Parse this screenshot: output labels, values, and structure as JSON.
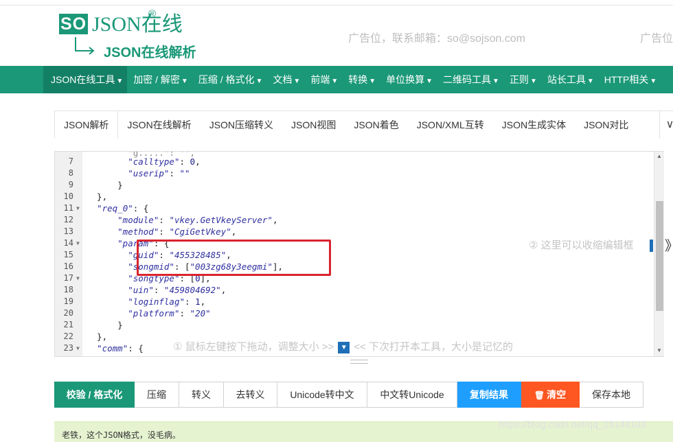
{
  "header": {
    "logo_so": "SO",
    "logo_json": "JSON在线",
    "logo_reg": "®",
    "logo_sub": "JSON在线解析",
    "ad_text": "广告位，联系邮箱：so@sojson.com",
    "ad_text_2": "广告位"
  },
  "nav": {
    "items": [
      {
        "label": "JSON在线工具"
      },
      {
        "label": "加密 / 解密"
      },
      {
        "label": "压缩 / 格式化"
      },
      {
        "label": "文档"
      },
      {
        "label": "前端"
      },
      {
        "label": "转换"
      },
      {
        "label": "单位换算"
      },
      {
        "label": "二维码工具"
      },
      {
        "label": "正则"
      },
      {
        "label": "站长工具"
      },
      {
        "label": "HTTP相关"
      }
    ],
    "caret": "▼"
  },
  "tabs": {
    "items": [
      "JSON解析",
      "JSON在线解析",
      "JSON压缩转义",
      "JSON视图",
      "JSON着色",
      "JSON/XML互转",
      "JSON生成实体",
      "JSON对比"
    ],
    "more": "∨"
  },
  "editor": {
    "lines": [
      {
        "n": "7",
        "fold": "",
        "html": "        <span class=\"k\">\"calltype\"</span>: <span class=\"n\">0</span>,"
      },
      {
        "n": "8",
        "fold": "",
        "html": "        <span class=\"k\">\"userip\"</span>: <span class=\"s\">\"\"</span>"
      },
      {
        "n": "9",
        "fold": "",
        "html": "      }"
      },
      {
        "n": "10",
        "fold": "",
        "html": "  },"
      },
      {
        "n": "11",
        "fold": "▼",
        "html": "  <span class=\"k\">\"req_0\"</span>: {"
      },
      {
        "n": "12",
        "fold": "",
        "html": "      <span class=\"k\">\"module\"</span>: <span class=\"s\">\"vkey.GetVkeyServer\"</span>,"
      },
      {
        "n": "13",
        "fold": "",
        "html": "      <span class=\"k\">\"method\"</span>: <span class=\"s\">\"CgiGetVkey\"</span>,"
      },
      {
        "n": "14",
        "fold": "▼",
        "html": "      <span class=\"k\">\"param\"</span>: {"
      },
      {
        "n": "15",
        "fold": "",
        "html": "        <span class=\"k\">\"guid\"</span>: <span class=\"s\">\"455328485\"</span>,"
      },
      {
        "n": "16",
        "fold": "",
        "html": "        <span class=\"k\">\"songmid\"</span>: [<span class=\"s\">\"003zg68y3eegmi\"</span>],"
      },
      {
        "n": "17",
        "fold": "▼",
        "html": "        <span class=\"k\">\"songtype\"</span>: [<span class=\"n\">0</span>],"
      },
      {
        "n": "18",
        "fold": "",
        "html": "        <span class=\"k\">\"uin\"</span>: <span class=\"s\">\"459804692\"</span>,"
      },
      {
        "n": "19",
        "fold": "",
        "html": "        <span class=\"k\">\"loginflag\"</span>: <span class=\"n\">1</span>,"
      },
      {
        "n": "20",
        "fold": "",
        "html": "        <span class=\"k\">\"platform\"</span>: <span class=\"s\">\"20\"</span>"
      },
      {
        "n": "21",
        "fold": "",
        "html": "      }"
      },
      {
        "n": "22",
        "fold": "",
        "html": "  },"
      },
      {
        "n": "23",
        "fold": "▼",
        "html": "  <span class=\"k\">\"comm\"</span>: {"
      }
    ]
  },
  "hints": {
    "resize_hint_a": "① 鼠标左键按下拖动，调整大小 >>",
    "resize_btn": "▼",
    "resize_hint_b": "<< 下次打开本工具，大小是记忆的",
    "collapse_hint": "② 这里可以收缩编辑框",
    "collapse_arrow": "》"
  },
  "toolbar": {
    "validate": "校验 / 格式化",
    "compress": "压缩",
    "escape": "转义",
    "unescape": "去转义",
    "unicode_to_cn": "Unicode转中文",
    "cn_to_unicode": "中文转Unicode",
    "copy": "复制结果",
    "clear": "清空",
    "clear_icon": "🗑",
    "save": "保存本地"
  },
  "result": {
    "message": "老铁，这个JSON格式，没毛病。"
  },
  "watermark": "https://blog.csdn.net/qq_16146103",
  "colors": {
    "brand": "#1a9878",
    "blue": "#1e9fff",
    "orange": "#ff5722",
    "highlight": "#d9232d"
  }
}
